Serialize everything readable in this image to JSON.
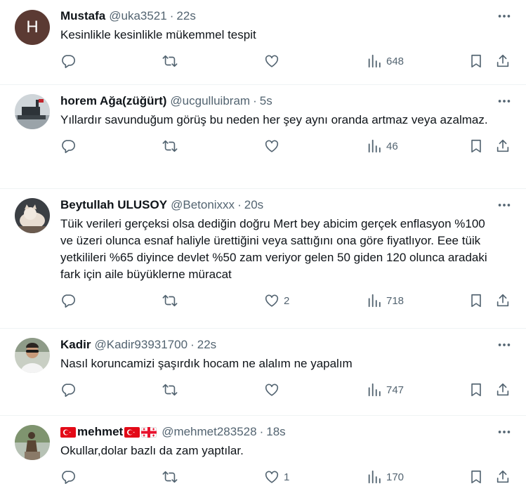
{
  "tweets": [
    {
      "avatar": {
        "type": "letter",
        "letter": "H",
        "color": "#5b3a33"
      },
      "name": "Mustafa",
      "handle": "@uka3521",
      "time": "22s",
      "text": "Kesinlikle kesinlikle mükemmel tespit",
      "replies": "",
      "retweets": "",
      "likes": "",
      "views": "648"
    },
    {
      "avatar": {
        "type": "image",
        "icon": "ship-icon"
      },
      "name": "horem Ağa(züğürt)",
      "handle": "@ucgulluibram",
      "time": "5s",
      "text": "Yıllardır savunduğum görüş bu  neden her şey aynı oranda artmaz veya azalmaz.",
      "replies": "",
      "retweets": "",
      "likes": "",
      "views": "46"
    },
    {
      "avatar": {
        "type": "image",
        "icon": "cat-icon"
      },
      "name": "Beytullah ULUSOY",
      "handle": "@Betonixxx",
      "time": "20s",
      "text": "Tüik verileri gerçeksi olsa dediğin doğru Mert bey abicim gerçek enflasyon %100 ve üzeri olunca esnaf haliyle ürettiğini veya sattığını ona göre fiyatlıyor. Eee tüik yetkilileri %65 diyince devlet %50 zam veriyor gelen 50 giden 120 olunca aradaki fark için aile büyüklerne müracat",
      "replies": "",
      "retweets": "",
      "likes": "2",
      "views": "718"
    },
    {
      "avatar": {
        "type": "image",
        "icon": "person-icon"
      },
      "name": "Kadir",
      "handle": "@Kadir93931700",
      "time": "22s",
      "text": "Nasıl koruncamizi şaşırdık hocam  ne alalım ne yapalım",
      "replies": "",
      "retweets": "",
      "likes": "",
      "views": "747"
    },
    {
      "avatar": {
        "type": "image",
        "icon": "statue-icon"
      },
      "name": "mehmet",
      "name_flags": [
        "turkey-flag-icon",
        "turkey-flag-icon",
        "georgia-flag-icon"
      ],
      "handle": "@mehmet283528",
      "time": "18s",
      "text": "Okullar,dolar bazlı da zam yaptılar.",
      "replies": "",
      "retweets": "",
      "likes": "1",
      "views": "170"
    }
  ],
  "separator": "·",
  "colors": {
    "text": "#0f1419",
    "secondary": "#536471",
    "border": "#eff3f4"
  }
}
